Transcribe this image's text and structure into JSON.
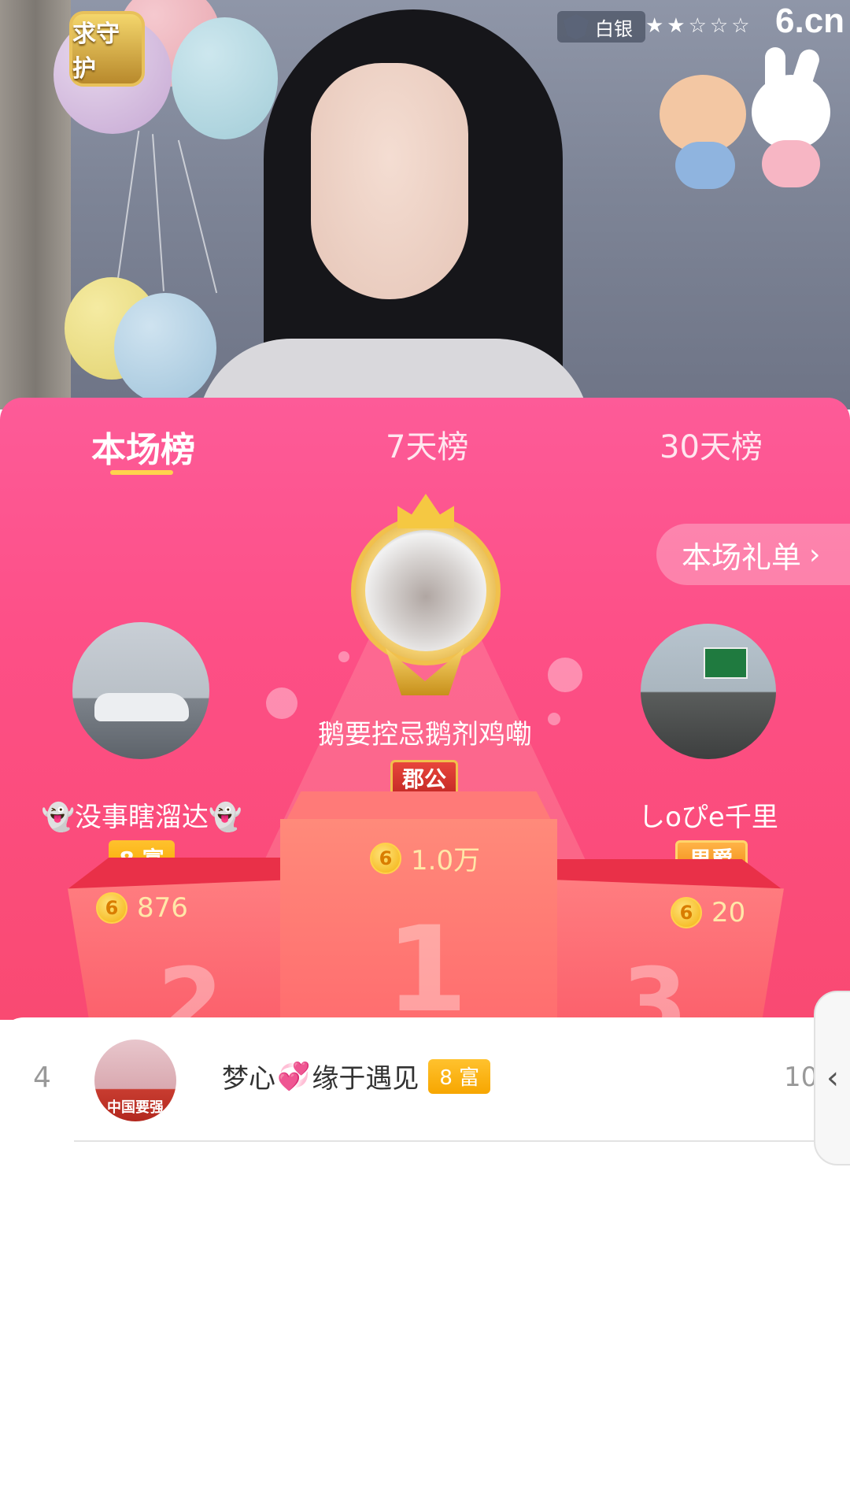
{
  "stream": {
    "guard_label": "求守护",
    "level_label": "白银",
    "stars": "★★☆☆☆",
    "site_logo": "6.cn"
  },
  "tabs": [
    {
      "label": "本场榜",
      "active": true
    },
    {
      "label": "7天榜",
      "active": false
    },
    {
      "label": "30天榜",
      "active": false
    }
  ],
  "gift_list_button": "本场礼单",
  "podium": {
    "first": {
      "name": "鹅要控忌鹅剂鸡嘞",
      "badge": "郡公",
      "score": "1.0万",
      "rank": "1"
    },
    "second": {
      "name": "👻没事瞎溜达👻",
      "badge": "8 富",
      "score": "876",
      "rank": "2"
    },
    "third": {
      "name": "しoぴe千里",
      "badge": "男爵",
      "score": "20",
      "rank": "3"
    }
  },
  "coin_symbol": "6",
  "list": [
    {
      "rank": "4",
      "name_a": "梦心",
      "heart": "💞",
      "name_b": "缘于遇见",
      "badge": "8 富",
      "value": "10",
      "avatar_caption": "中国要强"
    }
  ],
  "colors": {
    "panel_top": "#fd5b98",
    "panel_bottom": "#f94a72",
    "tab_underline": "#ffd34d",
    "score_text": "#ffe7a8",
    "rich_badge": "#f7a600"
  }
}
